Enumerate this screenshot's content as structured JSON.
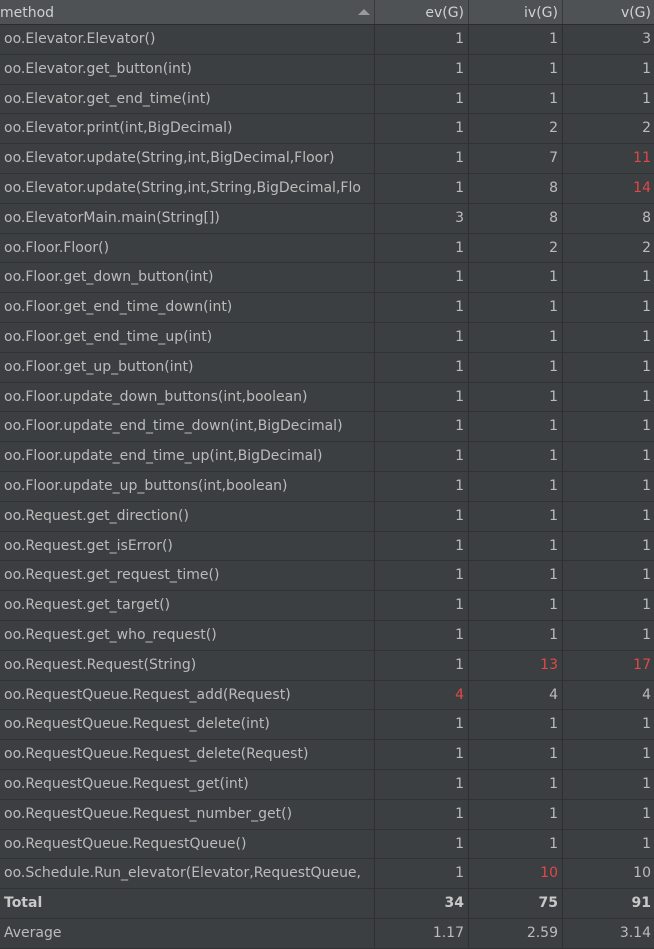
{
  "header": {
    "method": "method",
    "ev": "ev(G)",
    "iv": "iv(G)",
    "v": "v(G)"
  },
  "rows": [
    {
      "method": "oo.Elevator.Elevator()",
      "ev": "1",
      "iv": "1",
      "v": "3",
      "ev_warn": false,
      "iv_warn": false,
      "v_warn": false
    },
    {
      "method": "oo.Elevator.get_button(int)",
      "ev": "1",
      "iv": "1",
      "v": "1",
      "ev_warn": false,
      "iv_warn": false,
      "v_warn": false
    },
    {
      "method": "oo.Elevator.get_end_time(int)",
      "ev": "1",
      "iv": "1",
      "v": "1",
      "ev_warn": false,
      "iv_warn": false,
      "v_warn": false
    },
    {
      "method": "oo.Elevator.print(int,BigDecimal)",
      "ev": "1",
      "iv": "2",
      "v": "2",
      "ev_warn": false,
      "iv_warn": false,
      "v_warn": false
    },
    {
      "method": "oo.Elevator.update(String,int,BigDecimal,Floor)",
      "ev": "1",
      "iv": "7",
      "v": "11",
      "ev_warn": false,
      "iv_warn": false,
      "v_warn": true
    },
    {
      "method": "oo.Elevator.update(String,int,String,BigDecimal,Flo",
      "ev": "1",
      "iv": "8",
      "v": "14",
      "ev_warn": false,
      "iv_warn": false,
      "v_warn": true
    },
    {
      "method": "oo.ElevatorMain.main(String[])",
      "ev": "3",
      "iv": "8",
      "v": "8",
      "ev_warn": false,
      "iv_warn": false,
      "v_warn": false
    },
    {
      "method": "oo.Floor.Floor()",
      "ev": "1",
      "iv": "2",
      "v": "2",
      "ev_warn": false,
      "iv_warn": false,
      "v_warn": false
    },
    {
      "method": "oo.Floor.get_down_button(int)",
      "ev": "1",
      "iv": "1",
      "v": "1",
      "ev_warn": false,
      "iv_warn": false,
      "v_warn": false
    },
    {
      "method": "oo.Floor.get_end_time_down(int)",
      "ev": "1",
      "iv": "1",
      "v": "1",
      "ev_warn": false,
      "iv_warn": false,
      "v_warn": false
    },
    {
      "method": "oo.Floor.get_end_time_up(int)",
      "ev": "1",
      "iv": "1",
      "v": "1",
      "ev_warn": false,
      "iv_warn": false,
      "v_warn": false
    },
    {
      "method": "oo.Floor.get_up_button(int)",
      "ev": "1",
      "iv": "1",
      "v": "1",
      "ev_warn": false,
      "iv_warn": false,
      "v_warn": false
    },
    {
      "method": "oo.Floor.update_down_buttons(int,boolean)",
      "ev": "1",
      "iv": "1",
      "v": "1",
      "ev_warn": false,
      "iv_warn": false,
      "v_warn": false
    },
    {
      "method": "oo.Floor.update_end_time_down(int,BigDecimal)",
      "ev": "1",
      "iv": "1",
      "v": "1",
      "ev_warn": false,
      "iv_warn": false,
      "v_warn": false
    },
    {
      "method": "oo.Floor.update_end_time_up(int,BigDecimal)",
      "ev": "1",
      "iv": "1",
      "v": "1",
      "ev_warn": false,
      "iv_warn": false,
      "v_warn": false
    },
    {
      "method": "oo.Floor.update_up_buttons(int,boolean)",
      "ev": "1",
      "iv": "1",
      "v": "1",
      "ev_warn": false,
      "iv_warn": false,
      "v_warn": false
    },
    {
      "method": "oo.Request.get_direction()",
      "ev": "1",
      "iv": "1",
      "v": "1",
      "ev_warn": false,
      "iv_warn": false,
      "v_warn": false
    },
    {
      "method": "oo.Request.get_isError()",
      "ev": "1",
      "iv": "1",
      "v": "1",
      "ev_warn": false,
      "iv_warn": false,
      "v_warn": false
    },
    {
      "method": "oo.Request.get_request_time()",
      "ev": "1",
      "iv": "1",
      "v": "1",
      "ev_warn": false,
      "iv_warn": false,
      "v_warn": false
    },
    {
      "method": "oo.Request.get_target()",
      "ev": "1",
      "iv": "1",
      "v": "1",
      "ev_warn": false,
      "iv_warn": false,
      "v_warn": false
    },
    {
      "method": "oo.Request.get_who_request()",
      "ev": "1",
      "iv": "1",
      "v": "1",
      "ev_warn": false,
      "iv_warn": false,
      "v_warn": false
    },
    {
      "method": "oo.Request.Request(String)",
      "ev": "1",
      "iv": "13",
      "v": "17",
      "ev_warn": false,
      "iv_warn": true,
      "v_warn": true
    },
    {
      "method": "oo.RequestQueue.Request_add(Request)",
      "ev": "4",
      "iv": "4",
      "v": "4",
      "ev_warn": true,
      "iv_warn": false,
      "v_warn": false
    },
    {
      "method": "oo.RequestQueue.Request_delete(int)",
      "ev": "1",
      "iv": "1",
      "v": "1",
      "ev_warn": false,
      "iv_warn": false,
      "v_warn": false
    },
    {
      "method": "oo.RequestQueue.Request_delete(Request)",
      "ev": "1",
      "iv": "1",
      "v": "1",
      "ev_warn": false,
      "iv_warn": false,
      "v_warn": false
    },
    {
      "method": "oo.RequestQueue.Request_get(int)",
      "ev": "1",
      "iv": "1",
      "v": "1",
      "ev_warn": false,
      "iv_warn": false,
      "v_warn": false
    },
    {
      "method": "oo.RequestQueue.Request_number_get()",
      "ev": "1",
      "iv": "1",
      "v": "1",
      "ev_warn": false,
      "iv_warn": false,
      "v_warn": false
    },
    {
      "method": "oo.RequestQueue.RequestQueue()",
      "ev": "1",
      "iv": "1",
      "v": "1",
      "ev_warn": false,
      "iv_warn": false,
      "v_warn": false
    },
    {
      "method": "oo.Schedule.Run_elevator(Elevator,RequestQueue,",
      "ev": "1",
      "iv": "10",
      "v": "10",
      "ev_warn": false,
      "iv_warn": true,
      "v_warn": false
    }
  ],
  "total": {
    "label": "Total",
    "ev": "34",
    "iv": "75",
    "v": "91"
  },
  "average": {
    "label": "Average",
    "ev": "1.17",
    "iv": "2.59",
    "v": "3.14"
  },
  "colors": {
    "background": "#3c3f41",
    "header": "#4e5254",
    "text": "#bbbbbb",
    "warning": "#e04848"
  },
  "icons": {
    "sort": "sort-ascending-icon"
  }
}
